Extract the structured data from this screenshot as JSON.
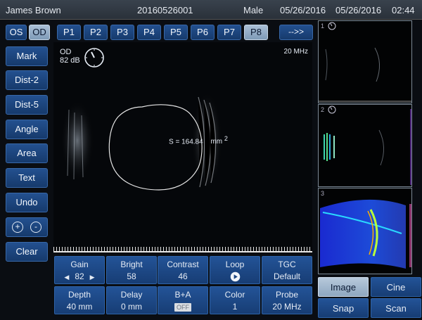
{
  "header": {
    "patient_name": "James Brown",
    "patient_id": "20160526001",
    "sex": "Male",
    "date1": "05/26/2016",
    "date2": "05/26/2016",
    "time": "02:44"
  },
  "eye_toggle": {
    "os": "OS",
    "od": "OD",
    "selected": "OD"
  },
  "presets": {
    "items": [
      "P1",
      "P2",
      "P3",
      "P4",
      "P5",
      "P6",
      "P7",
      "P8"
    ],
    "selected": "P8",
    "next": "-->>"
  },
  "sidebar": {
    "mark": "Mark",
    "dist2": "Dist-2",
    "dist5": "Dist-5",
    "angle": "Angle",
    "area": "Area",
    "text": "Text",
    "undo": "Undo",
    "zoom_in": "+",
    "zoom_out": "-",
    "clear": "Clear"
  },
  "image": {
    "eye": "OD",
    "gain_db": "82 dB",
    "frequency": "20 MHz",
    "measurement": "S = 164.84",
    "unit": "mm",
    "unit_exp": "2"
  },
  "controls": {
    "gain": {
      "label": "Gain",
      "value": "82"
    },
    "bright": {
      "label": "Bright",
      "value": "58"
    },
    "contrast": {
      "label": "Contrast",
      "value": "46"
    },
    "loop": {
      "label": "Loop",
      "value": ""
    },
    "tgc": {
      "label": "TGC",
      "value": "Default"
    },
    "depth": {
      "label": "Depth",
      "value": "40 mm"
    },
    "delay": {
      "label": "Delay",
      "value": "0 mm"
    },
    "ba": {
      "label": "B+A",
      "value": "OFF"
    },
    "color": {
      "label": "Color",
      "value": "1"
    },
    "probe": {
      "label": "Probe",
      "value": "20 MHz"
    }
  },
  "thumbnails": {
    "t1": "1",
    "t2": "2",
    "t3": "3"
  },
  "bottom": {
    "image": "Image",
    "cine": "Cine",
    "snap": "Snap",
    "scan": "Scan",
    "selected": "Image"
  },
  "colors": {
    "button_blue": "#1d4a8a",
    "selected_grey": "#9fb6cf",
    "header_bg": "#333b45",
    "background": "#0a0d12"
  }
}
